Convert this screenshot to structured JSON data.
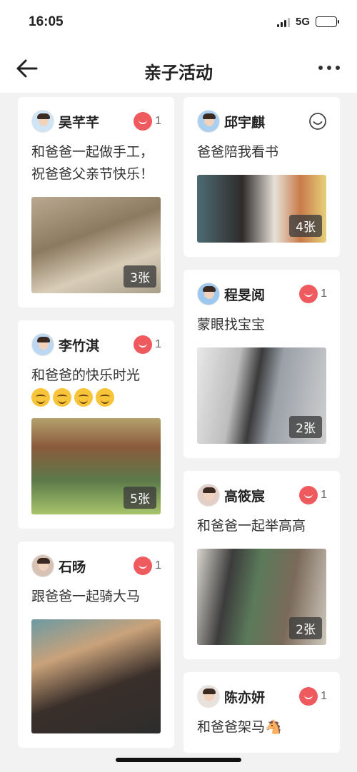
{
  "status_bar": {
    "time": "16:05",
    "network": "5G"
  },
  "header": {
    "title": "亲子活动"
  },
  "icons": {
    "back": "arrow-left-icon",
    "more": "more-dots-icon",
    "like_filled": "heart-filled-icon",
    "like_outline": "heart-outline-icon"
  },
  "colors": {
    "like": "#ef5a5f",
    "background": "#f2f2f2"
  },
  "left_posts": [
    {
      "name": "吴芊芊",
      "likes": "1",
      "text": "和爸爸一起做手工，祝爸爸父亲节快乐！",
      "photos": "3张"
    },
    {
      "name": "李竹淇",
      "likes": "1",
      "text": "和爸爸的快乐时光",
      "photos": "5张"
    },
    {
      "name": "石旸",
      "likes": "1",
      "text": "跟爸爸一起骑大马",
      "photos": ""
    }
  ],
  "right_posts": [
    {
      "name": "邱宇麒",
      "likes": "",
      "text": "爸爸陪我看书",
      "photos": "4张"
    },
    {
      "name": "程旻阅",
      "likes": "1",
      "text": "蒙眼找宝宝",
      "photos": "2张"
    },
    {
      "name": "高筱宸",
      "likes": "1",
      "text": "和爸爸一起举高高",
      "photos": "2张"
    },
    {
      "name": "陈亦妍",
      "likes": "1",
      "text": "和爸爸架马🐴",
      "photos": ""
    }
  ]
}
